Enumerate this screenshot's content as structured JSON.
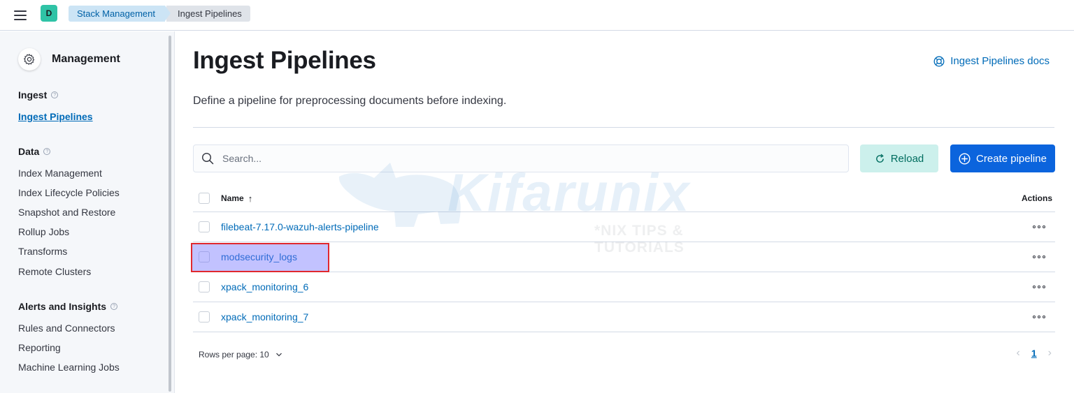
{
  "header": {
    "space_initial": "D",
    "breadcrumbs": [
      "Stack Management",
      "Ingest Pipelines"
    ]
  },
  "sidebar": {
    "title": "Management",
    "groups": [
      {
        "title": "Ingest",
        "items": [
          "Ingest Pipelines"
        ]
      },
      {
        "title": "Data",
        "items": [
          "Index Management",
          "Index Lifecycle Policies",
          "Snapshot and Restore",
          "Rollup Jobs",
          "Transforms",
          "Remote Clusters"
        ]
      },
      {
        "title": "Alerts and Insights",
        "items": [
          "Rules and Connectors",
          "Reporting",
          "Machine Learning Jobs"
        ]
      }
    ],
    "active_item": "Ingest Pipelines"
  },
  "main": {
    "title": "Ingest Pipelines",
    "docs_link": "Ingest Pipelines docs",
    "description": "Define a pipeline for preprocessing documents before indexing.",
    "search": {
      "placeholder": "Search...",
      "value": ""
    },
    "reload_label": "Reload",
    "create_label": "Create pipeline",
    "table": {
      "columns": {
        "name": "Name",
        "actions": "Actions"
      },
      "sort_indicator": "↑",
      "rows": [
        "filebeat-7.17.0-wazuh-alerts-pipeline",
        "modsecurity_logs",
        "xpack_monitoring_6",
        "xpack_monitoring_7"
      ],
      "highlighted_row": "modsecurity_logs"
    },
    "pagination": {
      "rows_per_page_label": "Rows per page: 10",
      "current_page": "1",
      "prev": "‹",
      "next": "›"
    }
  },
  "watermark": {
    "text": "Kifarunix",
    "subtitle": "*NIX TIPS & TUTORIALS"
  },
  "colors": {
    "accent": "#006bb8",
    "primary_button": "#0b64dd",
    "reload_button": "#ccf0ec",
    "space_avatar": "#2fc3a6",
    "highlight_border": "#e0282e"
  },
  "icons": [
    "menu-icon",
    "gear-icon",
    "help-circle-icon",
    "life-ring-icon",
    "search-icon",
    "refresh-icon",
    "plus-circle-icon",
    "sort-ascending-icon",
    "more-actions-icon",
    "chevron-down-icon",
    "chevron-left-icon",
    "chevron-right-icon"
  ]
}
